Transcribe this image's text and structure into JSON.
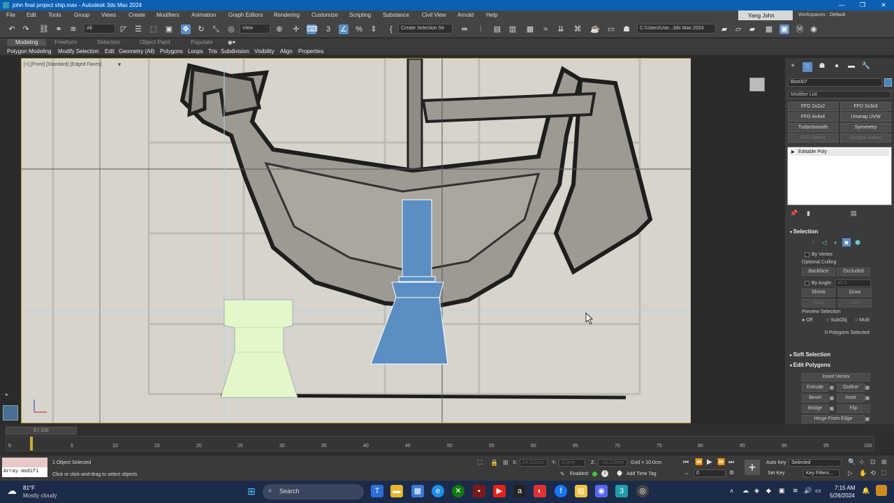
{
  "window": {
    "title": "john final project ship.max - Autodesk 3ds Max 2024",
    "min": "—",
    "max": "❐",
    "close": "✕"
  },
  "menu": [
    "File",
    "Edit",
    "Tools",
    "Group",
    "Views",
    "Create",
    "Modifiers",
    "Animation",
    "Graph Editors",
    "Rendering",
    "Customize",
    "Scripting",
    "Substance",
    "Civil View",
    "Arnold",
    "Help"
  ],
  "user": "Yang John",
  "workspace_label": "Workspaces:",
  "workspace": "Default",
  "toolbar": {
    "filter": "All",
    "view": "View",
    "selset": "Create Selection Se",
    "path": "C:\\Users\\Use...3ds Max 2024"
  },
  "ribbon": {
    "tabs": [
      "Modeling",
      "Freeform",
      "Selection",
      "Object Paint",
      "Populate"
    ],
    "sub": [
      "Polygon Modeling",
      "Modify Selection",
      "Edit",
      "Geometry (All)",
      "Polygons",
      "Loops",
      "Tris",
      "Subdivision",
      "Visibility",
      "Align",
      "Properties"
    ]
  },
  "viewport": {
    "label": "[+] [Front] [Standard] [Edged Faces]",
    "axis_x": "x",
    "axis_y": "y"
  },
  "panel": {
    "object_name": "Box007",
    "modifier_list": "Modifier List",
    "modifiers": [
      "FFD 2x2x2",
      "FFD 3x3x3",
      "FFD 4x4x4",
      "Unwrap UVW",
      "TurboSmooth",
      "Symmetry",
      "FFD Select",
      "Surface Select"
    ],
    "stack_item": "Editable Poly",
    "selection": {
      "title": "Selection",
      "by_vertex": "By Vertex",
      "optional_culling": "Optional Culling",
      "backface": "Backface",
      "occluded": "Occluded",
      "by_angle": "By Angle:",
      "angle_val": "45.0",
      "shrink": "Shrink",
      "grow": "Grow",
      "ring": "Ring",
      "loop": "Loop",
      "preview": "Preview Selection",
      "off": "Off",
      "subobj": "SubObj",
      "multi": "Multi",
      "count": "0 Polygons Selected"
    },
    "soft_selection": "Soft Selection",
    "edit_polygons": "Edit Polygons",
    "edit_buttons": [
      "Insert Vertex",
      "Extrude",
      "Outline",
      "Bevel",
      "Inset",
      "Bridge",
      "Flip",
      "Hinge From Edge"
    ]
  },
  "timeline": {
    "position": "0 / 100",
    "ticks": [
      "5",
      "10",
      "15",
      "20",
      "25",
      "30",
      "35",
      "40",
      "45",
      "50",
      "55",
      "60",
      "65",
      "70",
      "75",
      "80",
      "85",
      "90",
      "95",
      "100"
    ],
    "start": "0"
  },
  "status": {
    "selected": "1 Object Selected",
    "hint": "Click or click-and-drag to select objects",
    "script": "Array modifi",
    "x_label": "X:",
    "x": "24.221cm",
    "y_label": "Y:",
    "y": "0.0cm",
    "z_label": "Z:",
    "z": "-14.215cm",
    "grid": "Grid = 10.0cm",
    "enabled": "Enabled:",
    "add_time_tag": "Add Time Tag",
    "auto_key": "Auto Key",
    "set_key": "Set Key",
    "selected_dd": "Selected",
    "key_filters": "Key Filters...",
    "frame": "0"
  },
  "taskbar": {
    "weather_temp": "81°F",
    "weather_desc": "Mostly cloudy",
    "search": "Search",
    "time": "7:15 AM",
    "date": "5/26/2024"
  }
}
